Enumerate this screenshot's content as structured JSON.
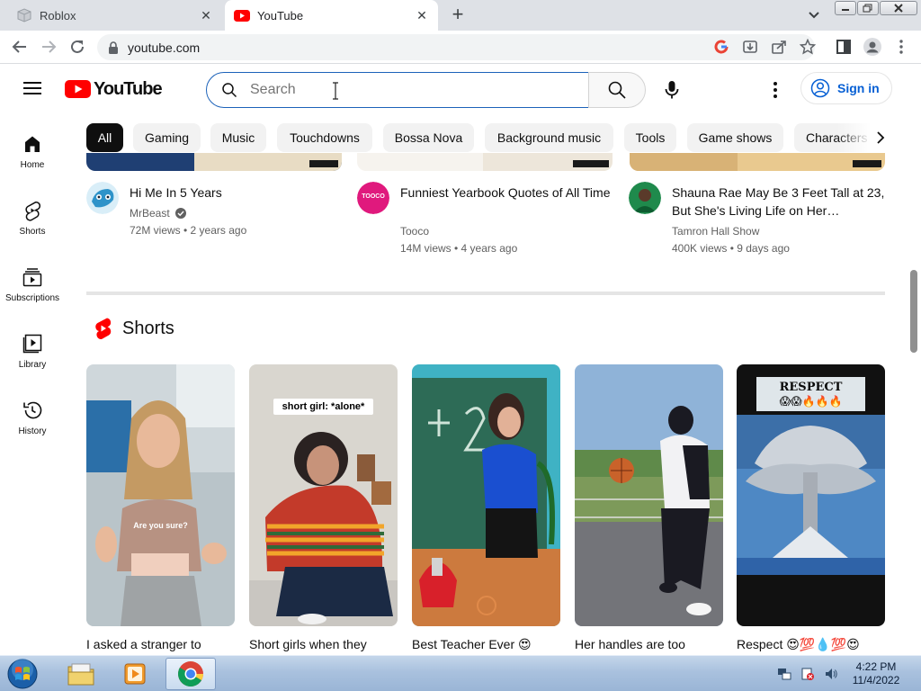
{
  "browser": {
    "tabs": [
      {
        "title": "Roblox",
        "active": false
      },
      {
        "title": "YouTube",
        "active": true
      }
    ],
    "new_tab_label": "+",
    "url": "youtube.com"
  },
  "masthead": {
    "logo_text": "YouTube",
    "search_placeholder": "Search",
    "signin_label": "Sign in"
  },
  "chips": [
    "All",
    "Gaming",
    "Music",
    "Touchdowns",
    "Bossa Nova",
    "Background music",
    "Tools",
    "Game shows",
    "Characters"
  ],
  "sidebar": {
    "items": [
      {
        "label": "Home",
        "icon": "home-icon"
      },
      {
        "label": "Shorts",
        "icon": "shorts-icon"
      },
      {
        "label": "Subscriptions",
        "icon": "subscriptions-icon"
      },
      {
        "label": "Library",
        "icon": "library-icon"
      },
      {
        "label": "History",
        "icon": "history-icon"
      }
    ]
  },
  "videos": [
    {
      "title": "Hi Me In 5 Years",
      "channel": "MrBeast",
      "verified": true,
      "meta": "72M views • 2 years ago",
      "avatar_text": ""
    },
    {
      "title": "Funniest Yearbook Quotes of All Time",
      "channel": "Tooco",
      "verified": false,
      "meta": "14M views • 4 years ago",
      "avatar_text": "TOOCO"
    },
    {
      "title": "Shauna Rae May Be 3 Feet Tall at 23, But She's Living Life on Her…",
      "channel": "Tamron Hall Show",
      "verified": false,
      "meta": "400K views • 9 days ago",
      "avatar_text": ""
    }
  ],
  "shorts": {
    "heading": "Shorts",
    "items": [
      {
        "title": "I asked a stranger to",
        "overlay": "Are you sure?"
      },
      {
        "title": "Short girls when they",
        "overlay": "short girl: *alone*"
      },
      {
        "title": "Best Teacher Ever 😍",
        "overlay": ""
      },
      {
        "title": "Her handles are too",
        "overlay": ""
      },
      {
        "title": "Respect 😍💯💧💯😍",
        "overlay": "RESPECT"
      }
    ],
    "respect_emoji": "😱😱🔥🔥🔥"
  },
  "taskbar": {
    "time": "4:22 PM",
    "date": "11/4/2022"
  },
  "colors": {
    "youtube_red": "#ff0000",
    "link_blue": "#065fd4",
    "chip_active": "#0f0f0f"
  }
}
